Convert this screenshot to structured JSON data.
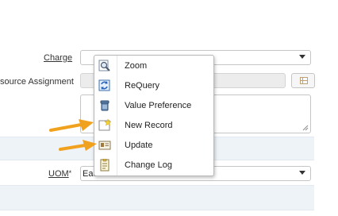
{
  "form": {
    "charge_label": "Charge",
    "resource_label": "source Assignment",
    "uom_label": "UOM",
    "uom_required": "*",
    "uom_value": "Eac"
  },
  "context_menu": {
    "items": [
      {
        "label": "Zoom",
        "icon": "zoom-icon"
      },
      {
        "label": "ReQuery",
        "icon": "requery-icon"
      },
      {
        "label": "Value Preference",
        "icon": "value-preference-icon"
      },
      {
        "label": "New Record",
        "icon": "new-record-icon"
      },
      {
        "label": "Update",
        "icon": "update-icon"
      },
      {
        "label": "Change Log",
        "icon": "change-log-icon"
      }
    ]
  },
  "colors": {
    "annotation_arrow": "#f0a21f",
    "band_background": "#eef3f8"
  }
}
